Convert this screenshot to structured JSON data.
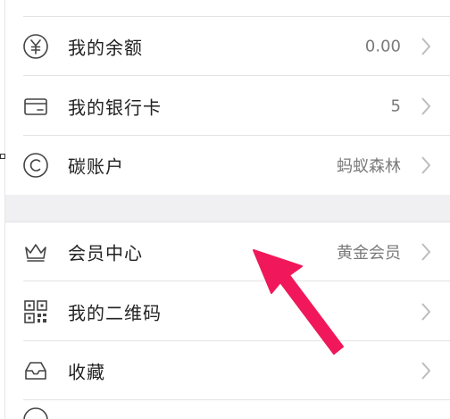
{
  "items": [
    {
      "label": "我的余额",
      "value": "0.00",
      "icon": "yuan-icon"
    },
    {
      "label": "我的银行卡",
      "value": "5",
      "icon": "bank-card-icon"
    },
    {
      "label": "碳账户",
      "value": "蚂蚁森林",
      "icon": "carbon-icon"
    },
    {
      "label": "会员中心",
      "value": "黄金会员",
      "icon": "crown-icon"
    },
    {
      "label": "我的二维码",
      "value": "",
      "icon": "qr-code-icon"
    },
    {
      "label": "收藏",
      "value": "",
      "icon": "favorites-tray-icon"
    }
  ],
  "colors": {
    "arrow": "#f0185a",
    "text": "#222222",
    "value": "#7a7a7a",
    "separator": "#e3e3e3",
    "group_gap": "#f0f0f3"
  }
}
